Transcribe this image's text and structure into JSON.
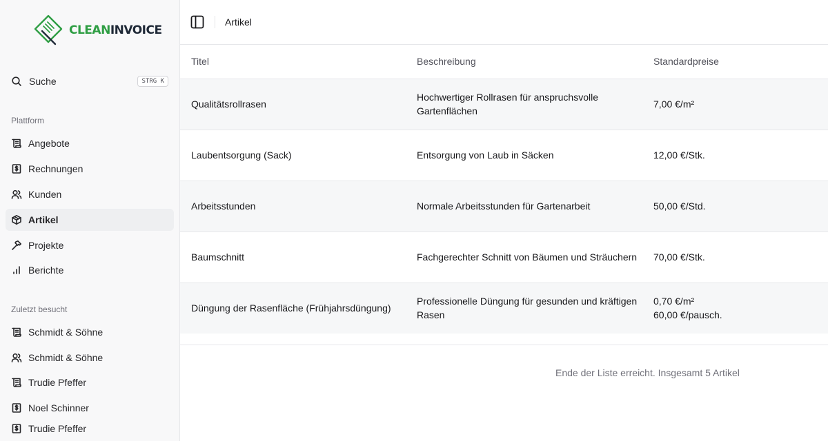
{
  "brand": {
    "part1": "CLEAN",
    "part2": "INVOICE"
  },
  "search": {
    "label": "Suche",
    "shortcut": "STRG K"
  },
  "platform": {
    "label": "Plattform",
    "items": [
      {
        "label": "Angebote",
        "icon": "scroll-icon"
      },
      {
        "label": "Rechnungen",
        "icon": "receipt-dollar-icon"
      },
      {
        "label": "Kunden",
        "icon": "users-icon"
      },
      {
        "label": "Artikel",
        "icon": "package-icon",
        "active": true
      },
      {
        "label": "Projekte",
        "icon": "hammer-icon"
      },
      {
        "label": "Berichte",
        "icon": "bar-chart-icon"
      }
    ]
  },
  "recent": {
    "label": "Zuletzt besucht",
    "items": [
      {
        "label": "Schmidt & Söhne",
        "icon": "scroll-icon"
      },
      {
        "label": "Schmidt & Söhne",
        "icon": "users-icon"
      },
      {
        "label": "Trudie Pfeffer",
        "icon": "scroll-icon"
      },
      {
        "label": "Noel Schinner",
        "icon": "receipt-dollar-icon"
      },
      {
        "label": "Trudie Pfeffer",
        "icon": "receipt-dollar-icon"
      }
    ]
  },
  "header": {
    "breadcrumb": "Artikel"
  },
  "table": {
    "columns": [
      "Titel",
      "Beschreibung",
      "Standardpreise"
    ],
    "rows": [
      {
        "title": "Qualitätsrollrasen",
        "description": "Hochwertiger Rollrasen für anspruchsvolle Gartenflächen",
        "prices": [
          "7,00 €/m²"
        ]
      },
      {
        "title": "Laubentsorgung (Sack)",
        "description": "Entsorgung von Laub in Säcken",
        "prices": [
          "12,00 €/Stk."
        ]
      },
      {
        "title": "Arbeitsstunden",
        "description": "Normale Arbeitsstunden für Gartenarbeit",
        "prices": [
          "50,00 €/Std."
        ]
      },
      {
        "title": "Baumschnitt",
        "description": "Fachgerechter Schnitt von Bäumen und Sträuchern",
        "prices": [
          "70,00 €/Stk."
        ]
      },
      {
        "title": "Düngung der Rasenfläche (Frühjahrsdüngung)",
        "description": "Professionelle Düngung für gesunden und kräftigen Rasen",
        "prices": [
          "0,70 €/m²",
          "60,00 €/pausch."
        ]
      }
    ]
  },
  "footer_note": "Ende der Liste erreicht. Insgesamt 5 Artikel",
  "colors": {
    "brand_green": "#2f9e44",
    "brand_dark": "#1f2937",
    "active_bg": "#eeeff1"
  }
}
